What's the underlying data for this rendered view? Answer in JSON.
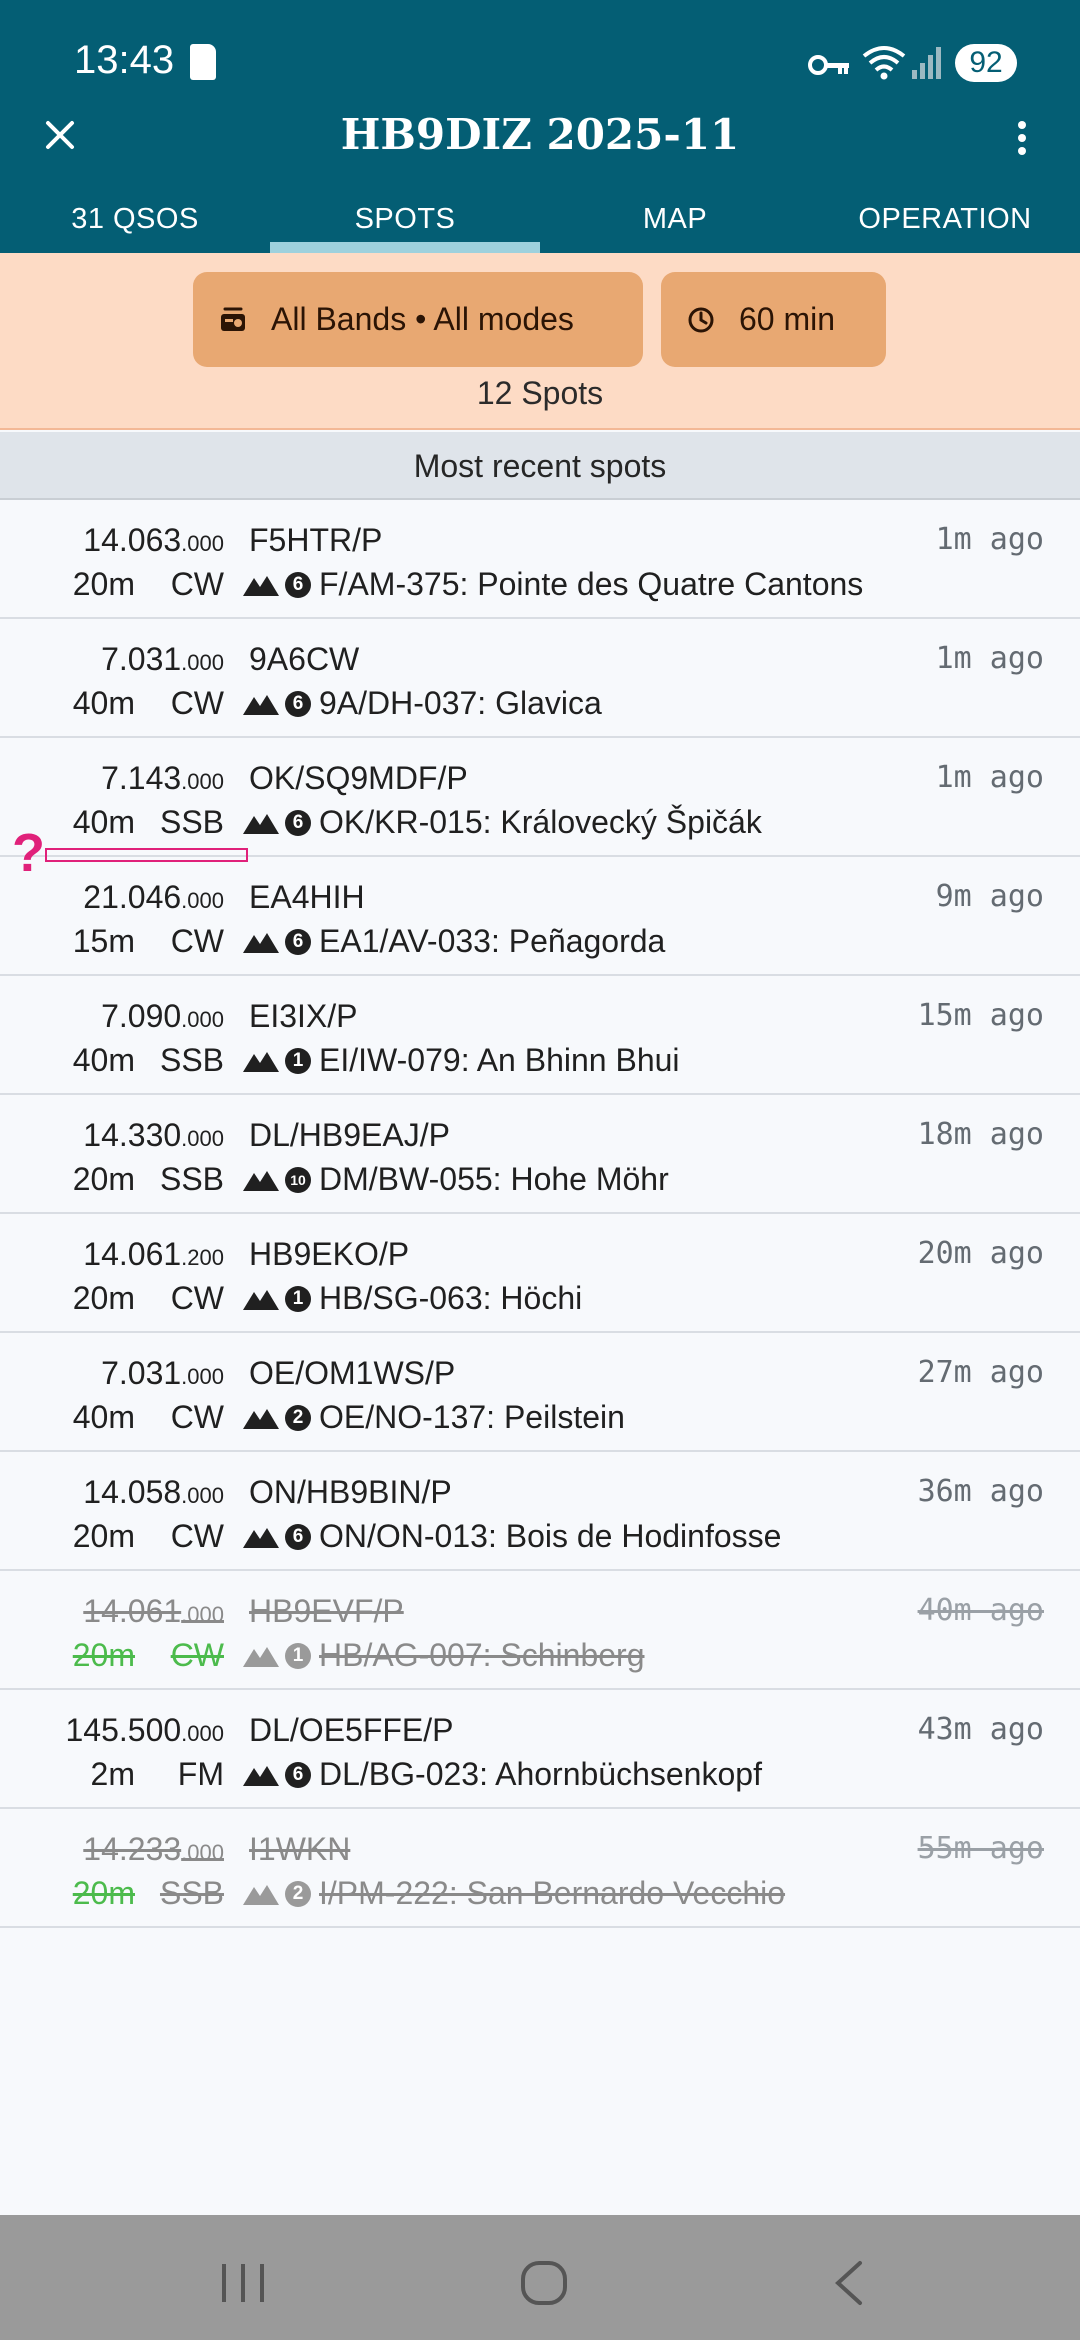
{
  "status": {
    "time": "13:43",
    "battery": "92"
  },
  "header": {
    "title": "HB9DIZ 2025-11"
  },
  "tabs": [
    {
      "label": "31 QSOS"
    },
    {
      "label": "SPOTS"
    },
    {
      "label": "MAP"
    },
    {
      "label": "OPERATION"
    }
  ],
  "filters": {
    "bands_label": "All Bands • All modes",
    "time_label": "60 min",
    "spots_count": "12 Spots"
  },
  "section": {
    "title": "Most recent spots"
  },
  "spots": [
    {
      "freq_main": "14.063",
      "freq_khz": ".000",
      "band": "20m",
      "mode": "CW",
      "call": "F5HTR/P",
      "points": "6",
      "ref": "F/AM-375: Pointe des Quatre Cantons",
      "ago": "1m ago"
    },
    {
      "freq_main": "7.031",
      "freq_khz": ".000",
      "band": "40m",
      "mode": "CW",
      "call": "9A6CW",
      "points": "6",
      "ref": "9A/DH-037: Glavica",
      "ago": "1m ago"
    },
    {
      "freq_main": "7.143",
      "freq_khz": ".000",
      "band": "40m",
      "mode": "SSB",
      "call": "OK/SQ9MDF/P",
      "points": "6",
      "ref": "OK/KR-015: Královecký Špičák",
      "ago": "1m ago"
    },
    {
      "freq_main": "21.046",
      "freq_khz": ".000",
      "band": "15m",
      "mode": "CW",
      "call": "EA4HIH",
      "points": "6",
      "ref": "EA1/AV-033: Peñagorda",
      "ago": "9m ago"
    },
    {
      "freq_main": "7.090",
      "freq_khz": ".000",
      "band": "40m",
      "mode": "SSB",
      "call": "EI3IX/P",
      "points": "1",
      "ref": "EI/IW-079: An Bhinn Bhui",
      "ago": "15m ago"
    },
    {
      "freq_main": "14.330",
      "freq_khz": ".000",
      "band": "20m",
      "mode": "SSB",
      "call": "DL/HB9EAJ/P",
      "points": "10",
      "ref": "DM/BW-055: Hohe Möhr",
      "ago": "18m ago"
    },
    {
      "freq_main": "14.061",
      "freq_khz": ".200",
      "band": "20m",
      "mode": "CW",
      "call": "HB9EKO/P",
      "points": "1",
      "ref": "HB/SG-063: Höchi",
      "ago": "20m ago"
    },
    {
      "freq_main": "7.031",
      "freq_khz": ".000",
      "band": "40m",
      "mode": "CW",
      "call": "OE/OM1WS/P",
      "points": "2",
      "ref": "OE/NO-137: Peilstein",
      "ago": "27m ago"
    },
    {
      "freq_main": "14.058",
      "freq_khz": ".000",
      "band": "20m",
      "mode": "CW",
      "call": "ON/HB9BIN/P",
      "points": "6",
      "ref": "ON/ON-013: Bois de Hodinfosse",
      "ago": "36m ago"
    },
    {
      "freq_main": "14.061",
      "freq_khz": ".000",
      "band": "20m",
      "mode": "CW",
      "call": "HB9EVF/P",
      "points": "1",
      "ref": "HB/AG-007: Schinberg",
      "ago": "40m ago"
    },
    {
      "freq_main": "145.500",
      "freq_khz": ".000",
      "band": "2m",
      "mode": "FM",
      "call": "DL/OE5FFE/P",
      "points": "6",
      "ref": "DL/BG-023: Ahornbüchsenkopf",
      "ago": "43m ago"
    },
    {
      "freq_main": "14.233",
      "freq_khz": ".000",
      "band": "20m",
      "mode": "SSB",
      "call": "I1WKN",
      "points": "2",
      "ref": "I/PM-222: San Bernardo Vecchio",
      "ago": "55m ago"
    }
  ],
  "colors": {
    "header_bg": "#045e74",
    "filter_bg": "#fddbc5",
    "chip_bg": "#e8a872",
    "worked_green": "#4cbb4c",
    "marker": "#e0217a"
  }
}
